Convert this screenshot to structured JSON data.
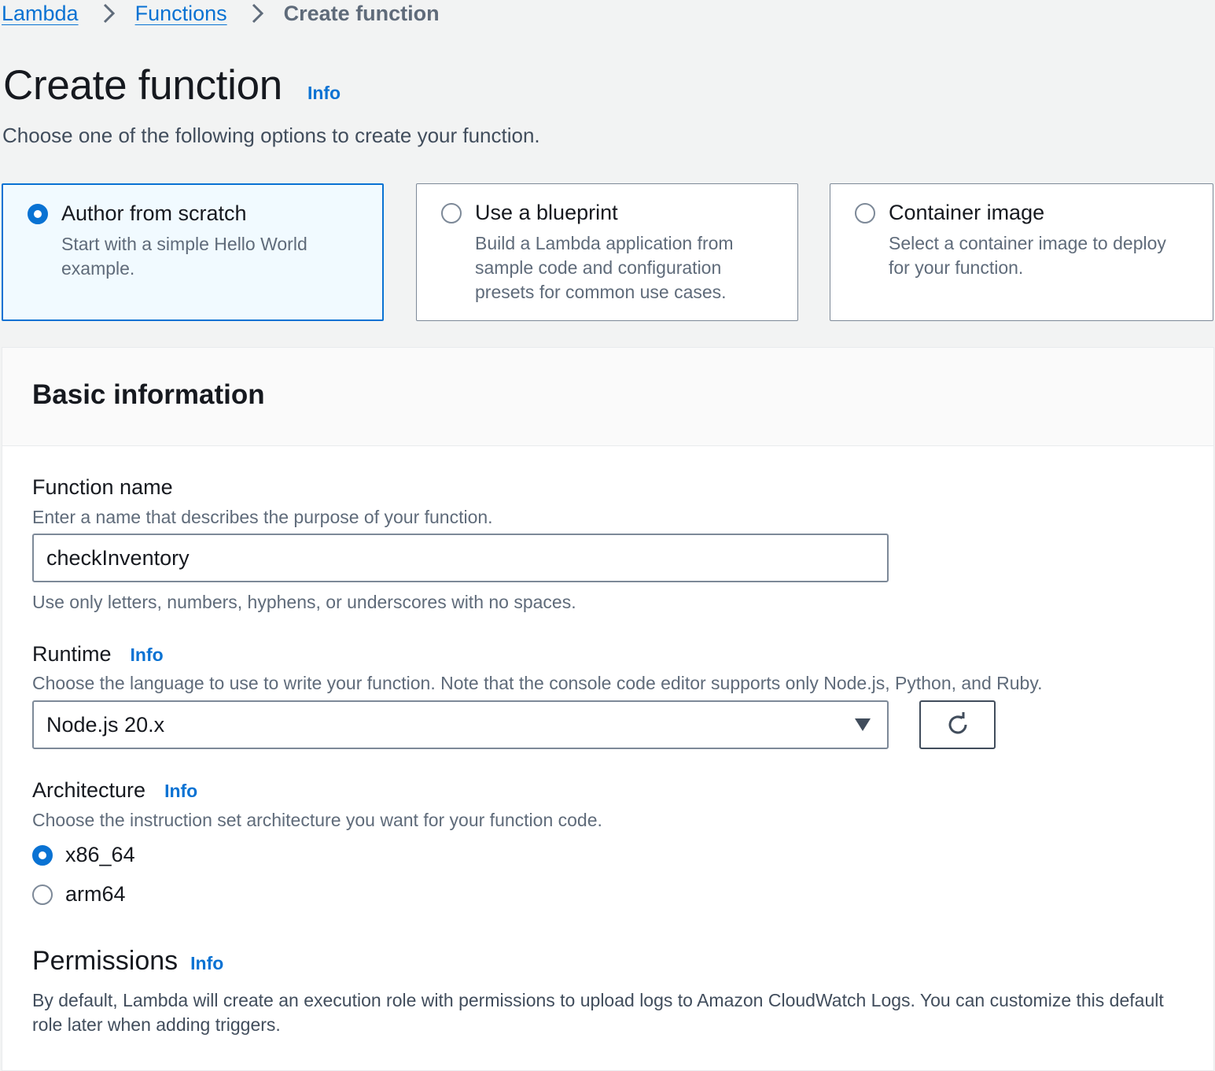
{
  "breadcrumb": {
    "items": [
      {
        "label": "Lambda"
      },
      {
        "label": "Functions"
      }
    ],
    "current": "Create function"
  },
  "page": {
    "title": "Create function",
    "info_label": "Info",
    "description": "Choose one of the following options to create your function."
  },
  "options": [
    {
      "title": "Author from scratch",
      "description": "Start with a simple Hello World example.",
      "selected": true
    },
    {
      "title": "Use a blueprint",
      "description": "Build a Lambda application from sample code and configuration presets for common use cases.",
      "selected": false
    },
    {
      "title": "Container image",
      "description": "Select a container image to deploy for your function.",
      "selected": false
    }
  ],
  "basic_info": {
    "title": "Basic information",
    "function_name": {
      "label": "Function name",
      "description": "Enter a name that describes the purpose of your function.",
      "value": "checkInventory",
      "constraint": "Use only letters, numbers, hyphens, or underscores with no spaces."
    },
    "runtime": {
      "label": "Runtime",
      "info_label": "Info",
      "description": "Choose the language to use to write your function. Note that the console code editor supports only Node.js, Python, and Ruby.",
      "selected": "Node.js 20.x",
      "refresh_icon": "refresh-icon"
    },
    "architecture": {
      "label": "Architecture",
      "info_label": "Info",
      "description": "Choose the instruction set architecture you want for your function code.",
      "options": [
        {
          "label": "x86_64",
          "selected": true
        },
        {
          "label": "arm64",
          "selected": false
        }
      ]
    },
    "permissions": {
      "title": "Permissions",
      "info_label": "Info",
      "description": "By default, Lambda will create an execution role with permissions to upload logs to Amazon CloudWatch Logs. You can customize this default role later when adding triggers."
    }
  },
  "colors": {
    "accent": "#0972d3",
    "selected_tile_bg": "#f1faff",
    "page_bg": "#f2f3f3",
    "text_primary": "#16191f",
    "text_secondary": "#5f6b7a"
  }
}
